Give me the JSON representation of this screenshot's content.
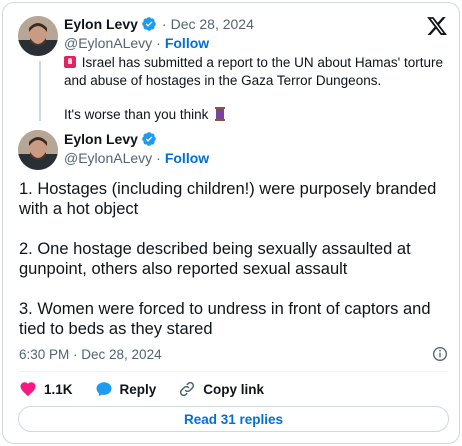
{
  "quoted_post": {
    "author_name": "Eylon Levy",
    "separator": "·",
    "date": "Dec 28, 2024",
    "handle": "@EylonALevy",
    "follow_label": "Follow",
    "text_line1": "Israel has submitted a report to the UN about Hamas' torture and abuse of hostages in the Gaza Terror Dungeons.",
    "text_line2": "It's worse than you think"
  },
  "main_post": {
    "author_name": "Eylon Levy",
    "handle": "@EylonALevy",
    "follow_label": "Follow",
    "paragraphs": [
      "1. Hostages (including children!) were purposely branded with a hot object",
      "2. One hostage described being sexually assaulted at gunpoint, others also reported sexual assault",
      "3. Women were forced to undress in front of captors and tied to beds as they stared"
    ],
    "timestamp": "6:30 PM · Dec 28, 2024"
  },
  "actions": {
    "like_count": "1.1K",
    "reply_label": "Reply",
    "copy_link_label": "Copy link"
  },
  "read_replies_label": "Read 31 replies",
  "colors": {
    "link_blue": "#006fd6",
    "verified_blue": "#1d9bf0",
    "like_red": "#f91880",
    "muted_text": "#536471",
    "border": "#cfd9de"
  },
  "icons": [
    "x-logo-icon",
    "verified-badge-icon",
    "siren-emoji-icon",
    "thread-emoji-icon",
    "info-icon",
    "heart-icon",
    "reply-icon",
    "link-icon"
  ]
}
